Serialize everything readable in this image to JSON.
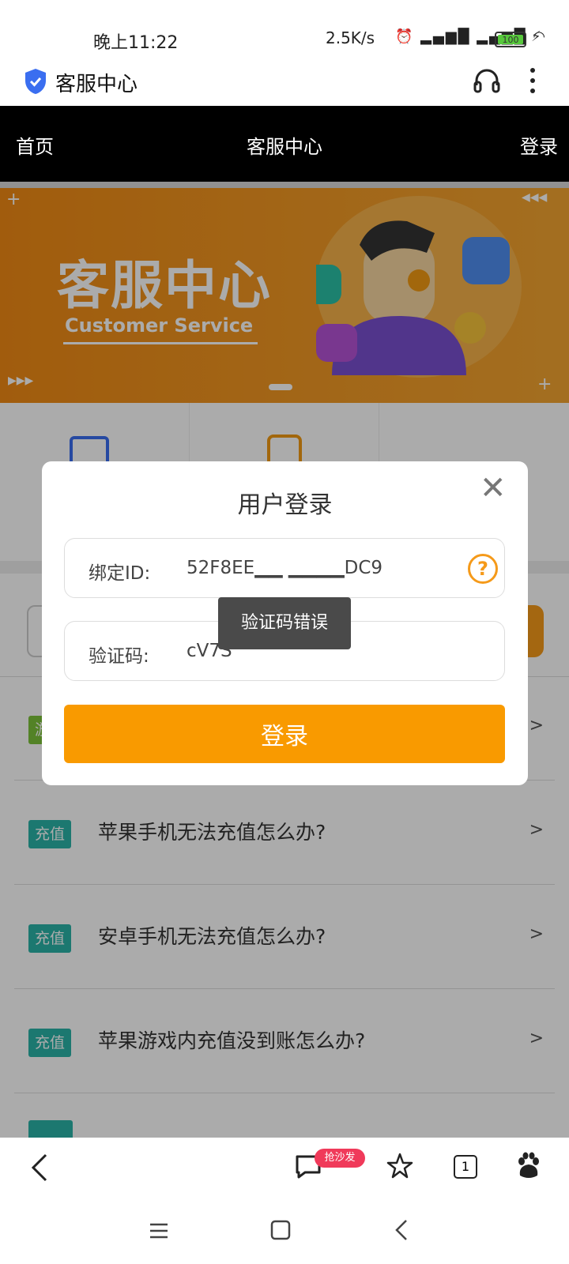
{
  "status_bar": {
    "time": "晚上11:22",
    "net_speed": "2.5K/s",
    "signal": "HD ıll HD ıll",
    "battery": "100"
  },
  "browser": {
    "url_title": "客服中心",
    "shield_icon": "shield-check-icon",
    "headset_icon": "headset-icon",
    "menu_icon": "kebab-menu-icon"
  },
  "site_header": {
    "home": "首页",
    "title": "客服中心",
    "login": "登录"
  },
  "banner": {
    "title_cn": "客服中心",
    "title_en": "Customer Service",
    "accent": "#f08a14"
  },
  "questions": [
    {
      "tag": "充值",
      "text": "苹果手机无法充值怎么办?",
      "arrow": ">"
    },
    {
      "tag": "充值",
      "text": "安卓手机无法充值怎么办?",
      "arrow": ">"
    },
    {
      "tag": "充值",
      "text": "苹果游戏内充值没到账怎么办?",
      "arrow": ">"
    }
  ],
  "first_row": {
    "tag": "游",
    "arrow": ">"
  },
  "dialog": {
    "title": "用户登录",
    "close": "✕",
    "id_label": "绑定ID:",
    "id_value": "52F8EE▁▁ ▁▁▁▁DC9",
    "help": "?",
    "code_label": "验证码:",
    "code_value": "cV7S",
    "submit": "登录"
  },
  "toast": "验证码错误",
  "toolbar": {
    "badge": "抢沙发",
    "tabs_count": "1"
  }
}
